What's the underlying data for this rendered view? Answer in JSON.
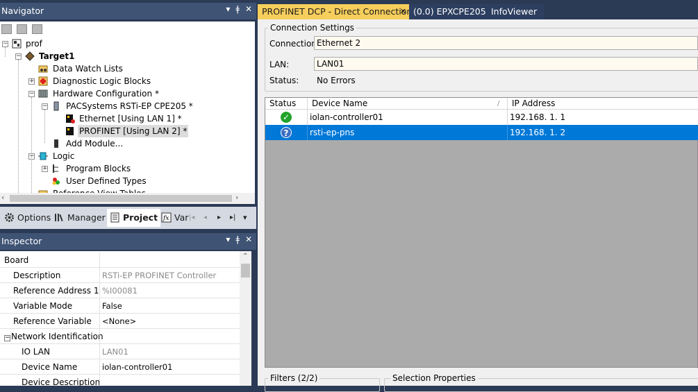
{
  "navigator": {
    "title": "Navigator",
    "tree": [
      {
        "label": "prof",
        "bold": false
      },
      {
        "label": "Target1",
        "bold": true
      },
      {
        "label": "Data Watch Lists",
        "bold": false
      },
      {
        "label": "Diagnostic Logic Blocks",
        "bold": false
      },
      {
        "label": "Hardware Configuration *",
        "bold": false
      },
      {
        "label": "PACSystems RSTi-EP CPE205 *",
        "bold": false
      },
      {
        "label": "Ethernet [Using LAN 1] *",
        "bold": false
      },
      {
        "label": "PROFINET [Using LAN 2] *",
        "bold": false
      },
      {
        "label": "Add Module...",
        "bold": false
      },
      {
        "label": "Logic",
        "bold": false
      },
      {
        "label": "Program Blocks",
        "bold": false
      },
      {
        "label": "User Defined Types",
        "bold": false
      },
      {
        "label": "Reference View Tables",
        "bold": false
      }
    ],
    "tabs": [
      {
        "label": "Options",
        "icon": "gear-icon"
      },
      {
        "label": "Manager",
        "icon": "library-icon"
      },
      {
        "label": "Project",
        "icon": "project-icon"
      },
      {
        "label": "Var",
        "icon": "function-icon"
      }
    ],
    "tab_nav": [
      "|◂",
      "◂",
      "▸",
      "▸|",
      "▾"
    ]
  },
  "inspector": {
    "title": "Inspector",
    "rows": [
      {
        "name": "Board",
        "value": "",
        "indent": 0,
        "disabled": false
      },
      {
        "name": "Description",
        "value": "RSTi-EP PROFINET Controller",
        "indent": 1,
        "disabled": true
      },
      {
        "name": "Reference Address 1",
        "value": "%I00081",
        "indent": 1,
        "disabled": true
      },
      {
        "name": "Variable Mode",
        "value": "False",
        "indent": 1,
        "disabled": false
      },
      {
        "name": "Reference Variable",
        "value": "<None>",
        "indent": 1,
        "disabled": false
      },
      {
        "name": "Network Identification",
        "value": "",
        "indent": 0,
        "disabled": false
      },
      {
        "name": "IO LAN",
        "value": "LAN01",
        "indent": 2,
        "disabled": true
      },
      {
        "name": "Device Name",
        "value": "iolan-controller01",
        "indent": 2,
        "disabled": false
      },
      {
        "name": "Device Description",
        "value": "",
        "indent": 2,
        "disabled": false
      }
    ]
  },
  "doc_tabs": [
    {
      "label": "PROFINET DCP - Direct Connection",
      "close": "✕",
      "active": true
    },
    {
      "label": "(0.0) EPXCPE205",
      "active": false
    },
    {
      "label": "InfoViewer",
      "active": false
    }
  ],
  "connection": {
    "group_title": "Connection Settings",
    "connection_label": "Connection:",
    "connection_value": "Ethernet 2",
    "lan_label": "LAN:",
    "lan_value": "LAN01",
    "status_label": "Status:",
    "status_value": "No Errors"
  },
  "devices": {
    "columns": [
      "Status",
      "Device Name",
      "IP Address"
    ],
    "sort_glyph": "/",
    "rows": [
      {
        "status": "ok",
        "status_glyph": "✓",
        "name": "iolan-controller01",
        "ip": "192.168.  1.  1"
      },
      {
        "status": "unknown",
        "status_glyph": "?",
        "name": "rsti-ep-pns",
        "ip": "192.168.  1.  2"
      }
    ]
  },
  "filters": {
    "title": "Filters  (2/2)"
  },
  "selection_properties": {
    "title": "Selection Properties"
  },
  "colors": {
    "accent_tab": "#f5ce5c",
    "selection": "#0078d7",
    "panel_title": "#3f5374"
  }
}
